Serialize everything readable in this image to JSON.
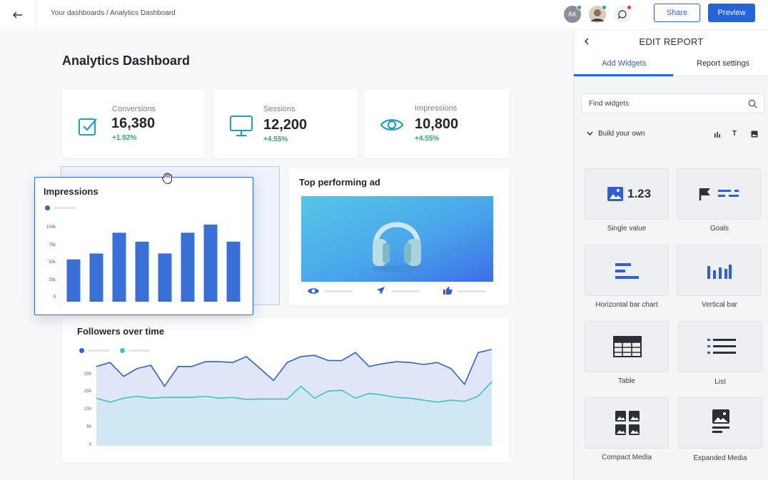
{
  "topbar": {
    "breadcrumb": "Your dashboards / Analytics Dashboard",
    "avatar_initials": "AK",
    "share_label": "Share",
    "preview_label": "Preview"
  },
  "dashboard": {
    "title": "Analytics Dashboard",
    "kpis": [
      {
        "label": "Conversions",
        "value": "16,380",
        "delta": "+1.92%",
        "icon": "checkbox-icon"
      },
      {
        "label": "Sessions",
        "value": "12,200",
        "delta": "+4.55%",
        "icon": "monitor-icon"
      },
      {
        "label": "Impressions",
        "value": "10,800",
        "delta": "+4.55%",
        "icon": "eye-icon"
      }
    ],
    "impressions_widget": {
      "title": "Impressions",
      "chart_data": {
        "type": "bar",
        "title": "Impressions",
        "yticks": [
          "100k",
          "75k",
          "50k",
          "25k",
          "0"
        ],
        "ylim": [
          0,
          100000
        ],
        "values": [
          57000,
          65000,
          93000,
          81000,
          65000,
          93000,
          104000,
          81000
        ]
      }
    },
    "top_ad_widget": {
      "title": "Top performing ad"
    },
    "followers_widget": {
      "title": "Followers over time",
      "chart_data": {
        "type": "area",
        "title": "Followers over time",
        "yticks": [
          "200",
          "150",
          "100",
          "50",
          "0"
        ],
        "ylim": [
          0,
          220
        ],
        "series": [
          {
            "values": [
              200,
              210,
              175,
              195,
              203,
              150,
              200,
              200,
              212,
              212,
              210,
              225,
              195,
              165,
              210,
              225,
              228,
              215,
              215,
              235,
              200,
              207,
              212,
              210,
              205,
              210,
              195,
              155,
              235,
              243
            ],
            "color": "#2f5fd0"
          },
          {
            "values": [
              120,
              110,
              120,
              125,
              120,
              122,
              122,
              122,
              125,
              120,
              122,
              117,
              118,
              118,
              118,
              150,
              120,
              138,
              140,
              120,
              132,
              128,
              122,
              120,
              115,
              110,
              115,
              112,
              125,
              162
            ],
            "color": "#3fc1c9"
          }
        ]
      },
      "colors": {
        "series1": "#2f5fd0",
        "series2": "#3fc1c9"
      }
    }
  },
  "panel": {
    "title": "EDIT REPORT",
    "tabs": [
      {
        "label": "Add Widgets",
        "active": true
      },
      {
        "label": "Report settings",
        "active": false
      }
    ],
    "search_placeholder": "Find widgets",
    "section_label": "Build your own",
    "widgets": [
      {
        "label": "Single value",
        "icon": "single-value-icon",
        "value_text": "1.23"
      },
      {
        "label": "Goals",
        "icon": "goals-icon"
      },
      {
        "label": "Horizontal bar chart",
        "icon": "horizontal-bar-icon"
      },
      {
        "label": "Vertical bar",
        "icon": "vertical-bar-icon"
      },
      {
        "label": "Table",
        "icon": "table-icon"
      },
      {
        "label": "List",
        "icon": "list-icon"
      },
      {
        "label": "Compact Media",
        "icon": "compact-media-icon"
      },
      {
        "label": "Expanded Media",
        "icon": "expanded-media-icon"
      }
    ]
  },
  "colors": {
    "accent": "#2563d9",
    "kpi_icon": "#1f9fc2",
    "positive": "#2fa36b",
    "bar": "#3a6fd8"
  }
}
